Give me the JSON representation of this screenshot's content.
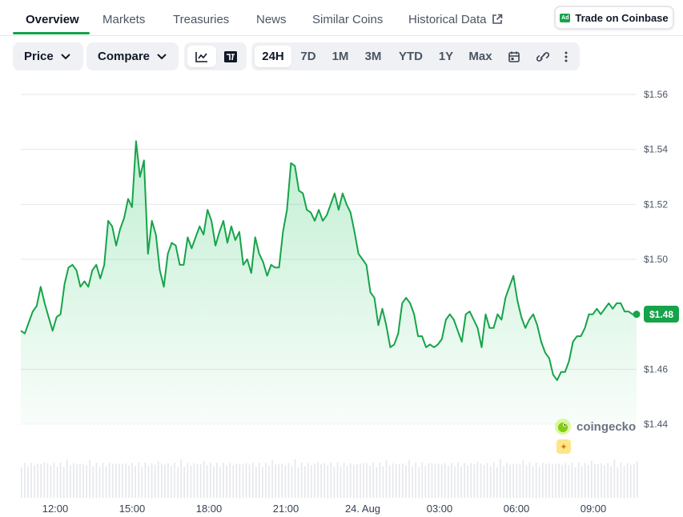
{
  "tabs": [
    {
      "label": "Overview",
      "active": true
    },
    {
      "label": "Markets"
    },
    {
      "label": "Treasuries"
    },
    {
      "label": "News"
    },
    {
      "label": "Similar Coins"
    },
    {
      "label": "Historical Data",
      "icon": "external-link-icon"
    }
  ],
  "trade_button": {
    "label": "Trade on Coinbase",
    "badge": "Ad"
  },
  "toolbar": {
    "price_dropdown": "Price",
    "compare_dropdown": "Compare",
    "chart_style": [
      "line-chart-icon",
      "tradingview-icon"
    ],
    "ranges": [
      "24H",
      "7D",
      "1M",
      "3M",
      "YTD",
      "1Y",
      "Max"
    ],
    "active_range": "24H",
    "tools": [
      "calendar-icon",
      "link-icon",
      "more-vertical-icon"
    ]
  },
  "watermark": "coingecko",
  "accent_color": "#16a34a",
  "chart_data": {
    "type": "area",
    "y_tick_labels": [
      "$1.56",
      "$1.54",
      "$1.52",
      "$1.50",
      "$1.46",
      "$1.44"
    ],
    "x_tick_labels": [
      "12:00",
      "15:00",
      "18:00",
      "21:00",
      "24. Aug",
      "03:00",
      "06:00",
      "09:00"
    ],
    "ylim": [
      1.44,
      1.56
    ],
    "current_price_label": "$1.48",
    "current_price": 1.48,
    "grid": true,
    "series": [
      {
        "values": [
          1.474,
          1.473,
          1.477,
          1.481,
          1.483,
          1.49,
          1.484,
          1.479,
          1.474,
          1.479,
          1.48,
          1.491,
          1.497,
          1.498,
          1.496,
          1.49,
          1.492,
          1.49,
          1.496,
          1.498,
          1.493,
          1.498,
          1.514,
          1.512,
          1.505,
          1.511,
          1.515,
          1.522,
          1.519,
          1.543,
          1.53,
          1.536,
          1.502,
          1.514,
          1.509,
          1.496,
          1.49,
          1.502,
          1.506,
          1.505,
          1.498,
          1.498,
          1.508,
          1.504,
          1.508,
          1.512,
          1.509,
          1.518,
          1.514,
          1.505,
          1.51,
          1.514,
          1.506,
          1.512,
          1.507,
          1.51,
          1.498,
          1.5,
          1.495,
          1.508,
          1.502,
          1.499,
          1.494,
          1.498,
          1.497,
          1.497,
          1.51,
          1.518,
          1.535,
          1.534,
          1.525,
          1.524,
          1.518,
          1.517,
          1.514,
          1.518,
          1.514,
          1.516,
          1.52,
          1.524,
          1.518,
          1.524,
          1.52,
          1.517,
          1.51,
          1.502,
          1.5,
          1.498,
          1.488,
          1.486,
          1.476,
          1.482,
          1.476,
          1.468,
          1.469,
          1.473,
          1.484,
          1.486,
          1.484,
          1.48,
          1.472,
          1.472,
          1.468,
          1.469,
          1.468,
          1.469,
          1.471,
          1.478,
          1.48,
          1.478,
          1.474,
          1.47,
          1.48,
          1.481,
          1.478,
          1.475,
          1.468,
          1.48,
          1.475,
          1.475,
          1.48,
          1.478,
          1.486,
          1.49,
          1.494,
          1.485,
          1.479,
          1.475,
          1.478,
          1.48,
          1.476,
          1.47,
          1.466,
          1.464,
          1.458,
          1.456,
          1.459,
          1.459,
          1.463,
          1.47,
          1.472,
          1.472,
          1.475,
          1.48,
          1.48,
          1.482,
          1.48,
          1.482,
          1.484,
          1.482,
          1.484,
          1.484,
          1.481,
          1.481,
          1.48,
          1.48
        ]
      }
    ]
  }
}
